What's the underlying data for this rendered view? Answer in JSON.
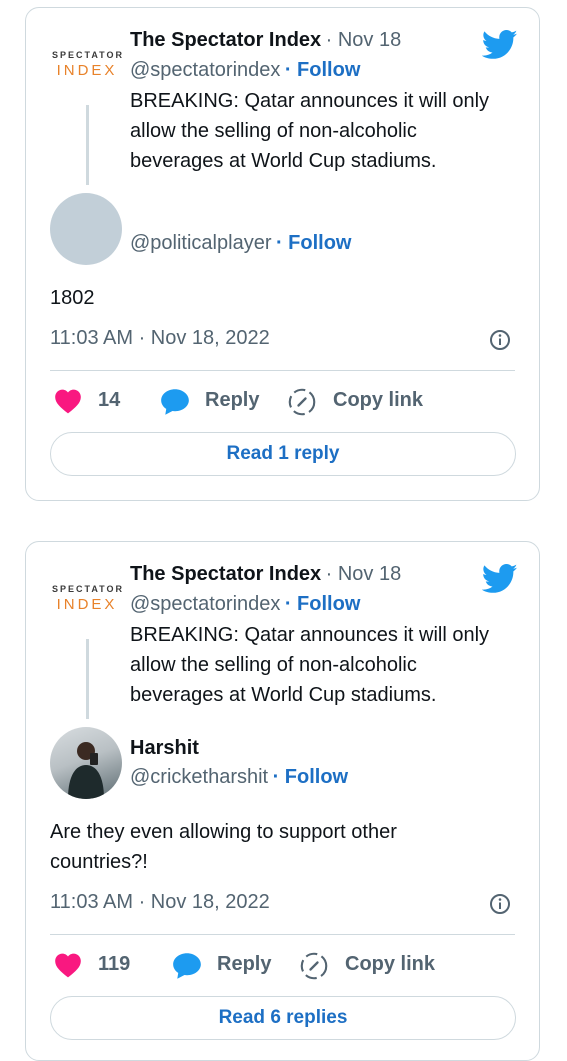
{
  "colors": {
    "accent": "#1d6fc4",
    "heart": "#f91880",
    "twitter": "#1d9bf0",
    "logo_orange": "#e8822a"
  },
  "tweets": [
    {
      "parent": {
        "logo_line1": "SPECTATOR",
        "logo_line2": "INDEX",
        "name": "The Spectator Index",
        "date": "· Nov 18",
        "handle": "@spectatorindex",
        "follow": "· Follow",
        "text_lines": [
          "BREAKING: Qatar announces it will only",
          "allow the selling of non-alcoholic",
          "beverages at World Cup stadiums."
        ]
      },
      "reply": {
        "name": "",
        "handle": "@politicalplayer",
        "follow": "· Follow",
        "text_lines": [
          "1802"
        ]
      },
      "timestamp": "11:03 AM · Nov 18, 2022",
      "likes": "14",
      "reply_label": "Reply",
      "copy_label": "Copy link",
      "read_label": "Read 1 reply"
    },
    {
      "parent": {
        "logo_line1": "SPECTATOR",
        "logo_line2": "INDEX",
        "name": "The Spectator Index",
        "date": "· Nov 18",
        "handle": "@spectatorindex",
        "follow": "· Follow",
        "text_lines": [
          "BREAKING: Qatar announces it will only",
          "allow the selling of non-alcoholic",
          "beverages at World Cup stadiums."
        ]
      },
      "reply": {
        "name": "Harshit",
        "handle": "@cricketharshit",
        "follow": "· Follow",
        "text_lines": [
          "Are they even allowing to support other",
          "countries?!"
        ]
      },
      "timestamp": "11:03 AM · Nov 18, 2022",
      "likes": "119",
      "reply_label": "Reply",
      "copy_label": "Copy link",
      "read_label": "Read 6 replies"
    }
  ]
}
